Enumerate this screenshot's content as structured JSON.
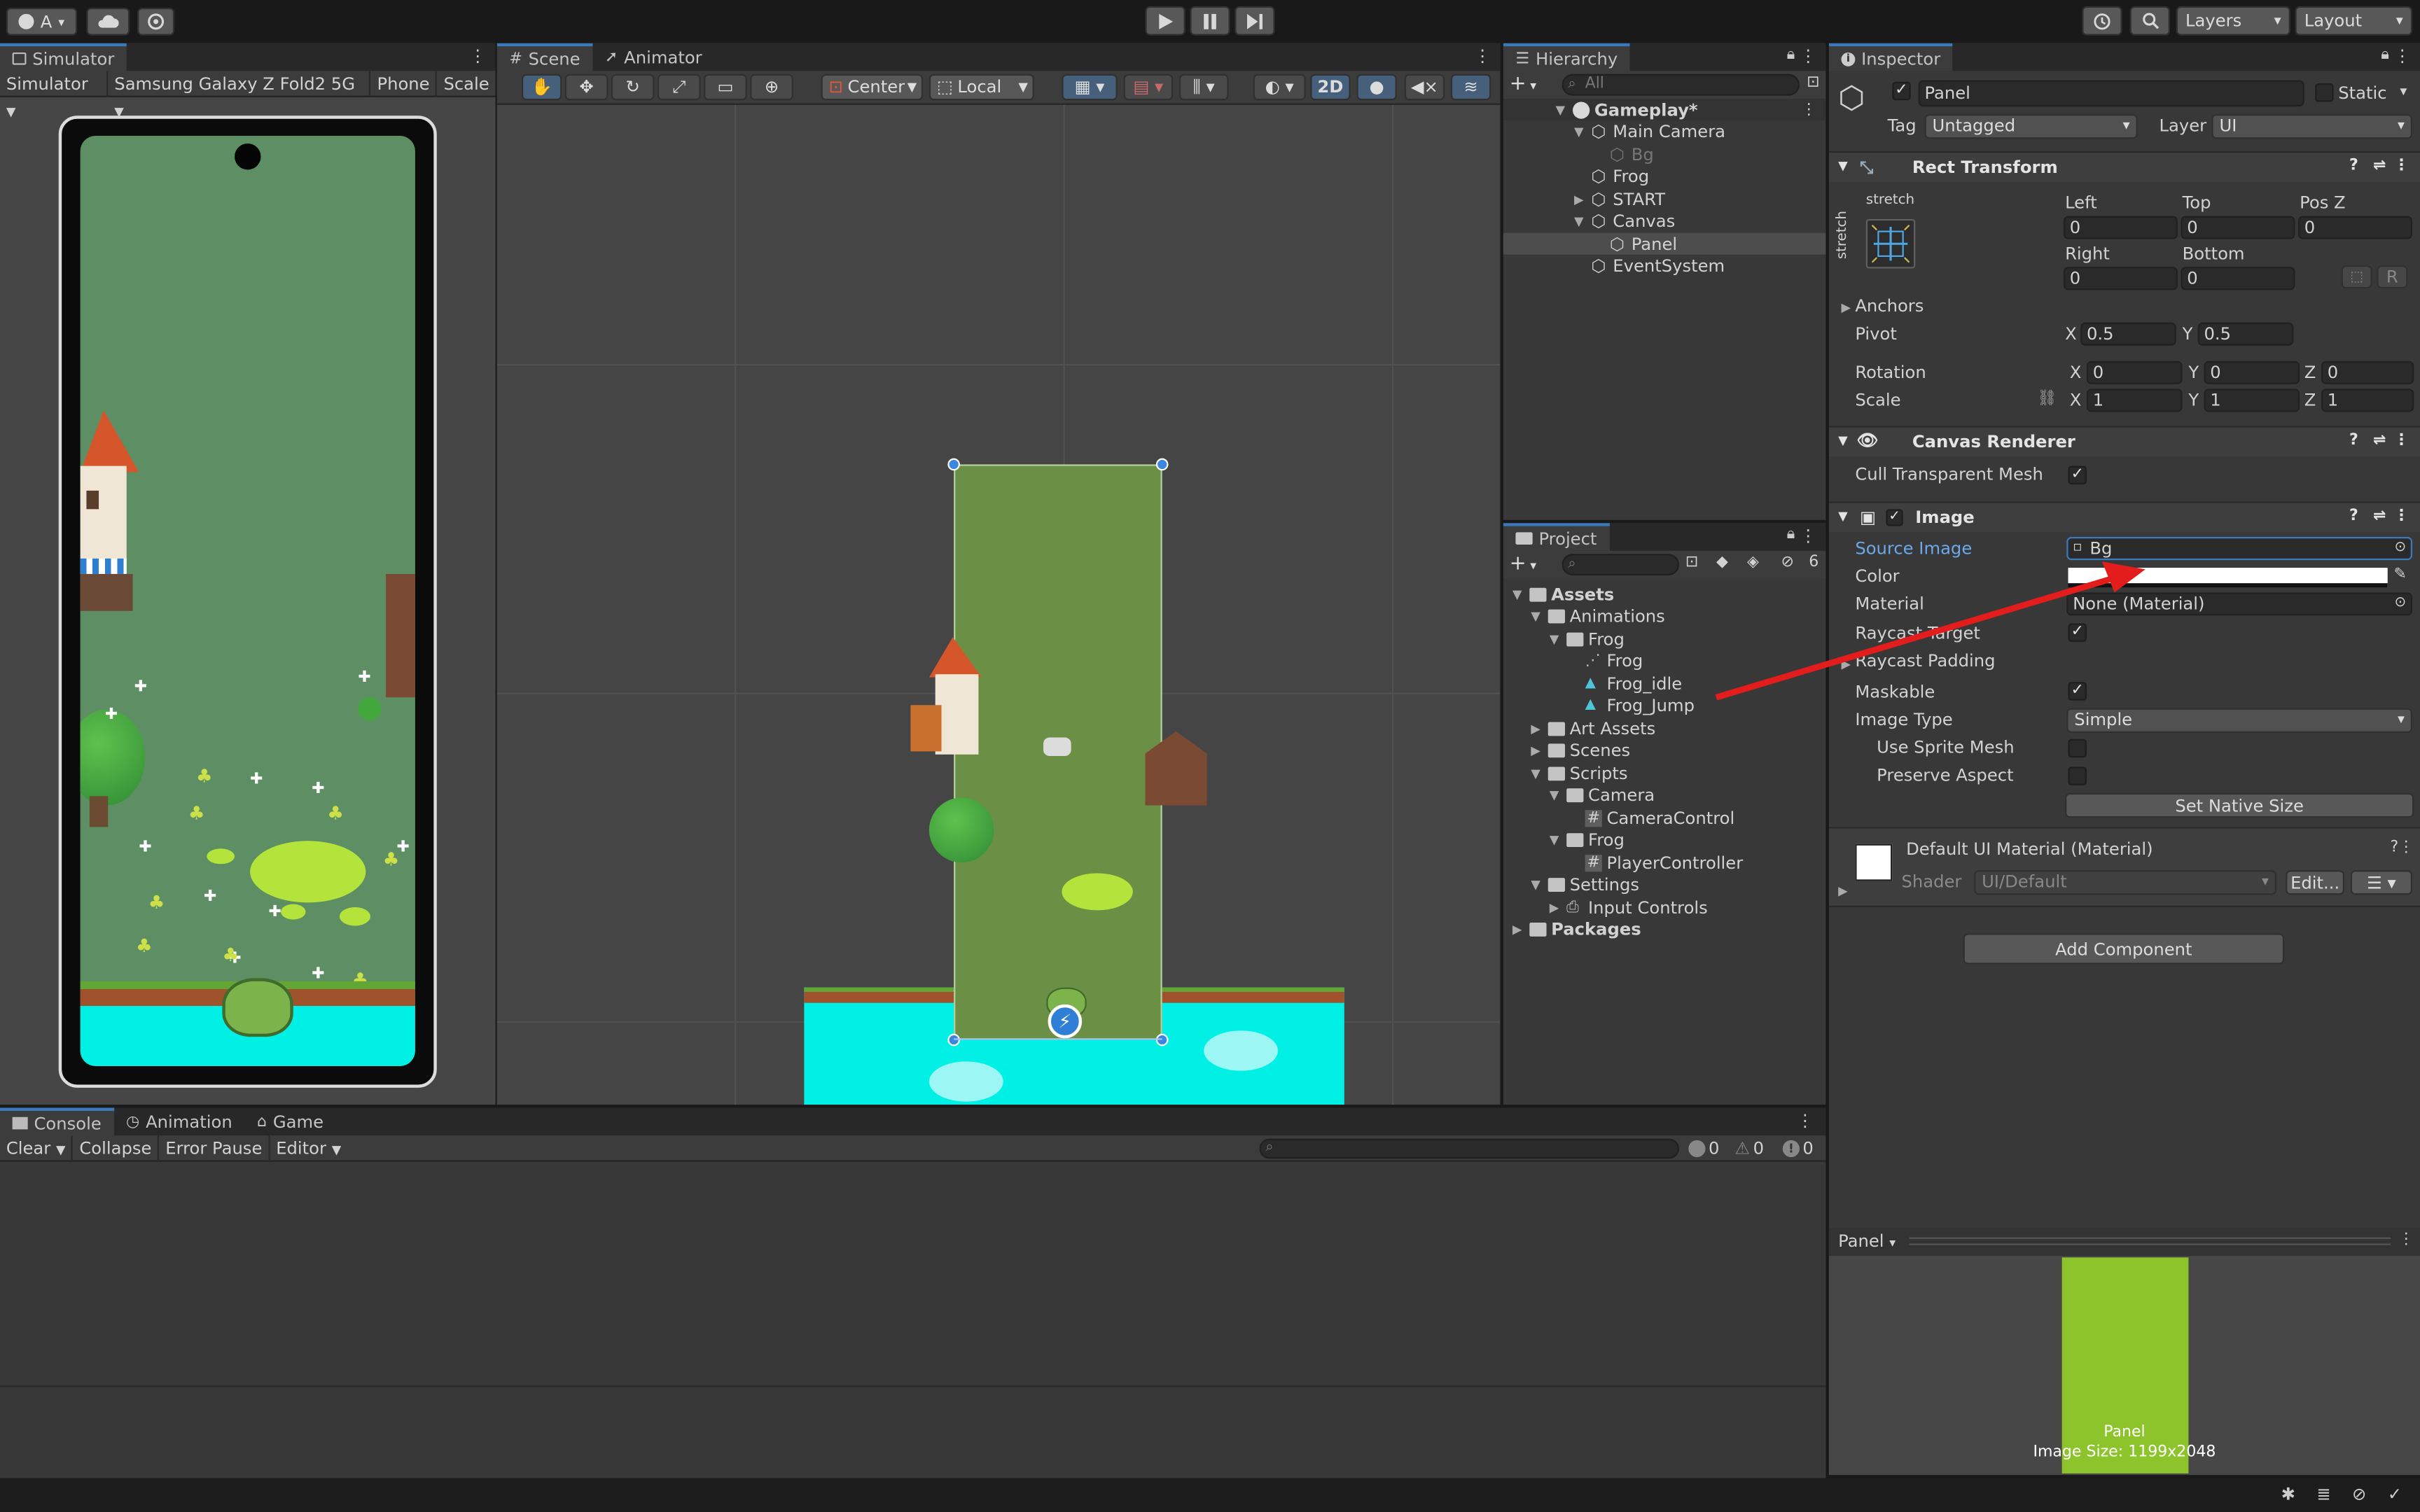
{
  "toolbar": {
    "account": "A",
    "layers": "Layers",
    "layout": "Layout"
  },
  "simulator": {
    "tab": "Simulator",
    "mode": "Simulator",
    "device": "Samsung Galaxy Z Fold2 5G",
    "platform": "Phone",
    "scale": "Scale"
  },
  "scene": {
    "tab_scene": "Scene",
    "tab_animator": "Animator",
    "pivot": "Center",
    "space": "Local",
    "two_d": "2D"
  },
  "hierarchy": {
    "tab": "Hierarchy",
    "search_placeholder": "All",
    "items": [
      {
        "label": "Gameplay*",
        "depth": 0,
        "arrow": "▼",
        "kind": "scene"
      },
      {
        "label": "Main Camera",
        "depth": 1,
        "arrow": "▼",
        "kind": "cube"
      },
      {
        "label": "Bg",
        "depth": 2,
        "arrow": "",
        "kind": "cube-dim"
      },
      {
        "label": "Frog",
        "depth": 1,
        "arrow": "",
        "kind": "cube"
      },
      {
        "label": "START",
        "depth": 1,
        "arrow": "▶",
        "kind": "cube"
      },
      {
        "label": "Canvas",
        "depth": 1,
        "arrow": "▼",
        "kind": "cube"
      },
      {
        "label": "Panel",
        "depth": 2,
        "arrow": "",
        "kind": "cube",
        "selected": true
      },
      {
        "label": "EventSystem",
        "depth": 1,
        "arrow": "",
        "kind": "cube"
      }
    ]
  },
  "project": {
    "tab": "Project",
    "hidden_count": "6",
    "items": [
      {
        "label": "Assets",
        "depth": 0,
        "arrow": "▼",
        "kind": "folder",
        "bold": true
      },
      {
        "label": "Animations",
        "depth": 1,
        "arrow": "▼",
        "kind": "folder"
      },
      {
        "label": "Frog",
        "depth": 2,
        "arrow": "▼",
        "kind": "folder"
      },
      {
        "label": "Frog",
        "depth": 3,
        "arrow": "",
        "kind": "anim-ctrl"
      },
      {
        "label": "Frog_idle",
        "depth": 3,
        "arrow": "",
        "kind": "anim"
      },
      {
        "label": "Frog_Jump",
        "depth": 3,
        "arrow": "",
        "kind": "anim"
      },
      {
        "label": "Art Assets",
        "depth": 1,
        "arrow": "▶",
        "kind": "folder"
      },
      {
        "label": "Scenes",
        "depth": 1,
        "arrow": "▶",
        "kind": "folder"
      },
      {
        "label": "Scripts",
        "depth": 1,
        "arrow": "▼",
        "kind": "folder"
      },
      {
        "label": "Camera",
        "depth": 2,
        "arrow": "▼",
        "kind": "folder"
      },
      {
        "label": "CameraControl",
        "depth": 3,
        "arrow": "",
        "kind": "script"
      },
      {
        "label": "Frog",
        "depth": 2,
        "arrow": "▼",
        "kind": "folder"
      },
      {
        "label": "PlayerController",
        "depth": 3,
        "arrow": "",
        "kind": "script"
      },
      {
        "label": "Settings",
        "depth": 1,
        "arrow": "▼",
        "kind": "folder"
      },
      {
        "label": "Input Controls",
        "depth": 2,
        "arrow": "▶",
        "kind": "input"
      },
      {
        "label": "Packages",
        "depth": 0,
        "arrow": "▶",
        "kind": "folder",
        "bold": true
      }
    ]
  },
  "inspector": {
    "tab": "Inspector",
    "object_name": "Panel",
    "static": "Static",
    "tag_label": "Tag",
    "tag": "Untagged",
    "layer_label": "Layer",
    "layer": "UI",
    "rect": {
      "title": "Rect Transform",
      "anchor_preset": "stretch",
      "left_label": "Left",
      "top_label": "Top",
      "posz_label": "Pos Z",
      "left": "0",
      "top": "0",
      "posz": "0",
      "right_label": "Right",
      "bottom_label": "Bottom",
      "right": "0",
      "bottom": "0",
      "r_btn": "R",
      "anchors": "Anchors",
      "pivot": "Pivot",
      "pivot_x": "0.5",
      "pivot_y": "0.5",
      "rotation": "Rotation",
      "rot_x": "0",
      "rot_y": "0",
      "rot_z": "0",
      "scale": "Scale",
      "scale_x": "1",
      "scale_y": "1",
      "scale_z": "1",
      "x": "X",
      "y": "Y",
      "z": "Z"
    },
    "canvas_renderer": {
      "title": "Canvas Renderer",
      "cull": "Cull Transparent Mesh"
    },
    "image": {
      "title": "Image",
      "source_image": "Source Image",
      "source_value": "Bg",
      "color": "Color",
      "color_value": "#ffffff",
      "material": "Material",
      "material_value": "None (Material)",
      "raycast_target": "Raycast Target",
      "raycast_padding": "Raycast Padding",
      "maskable": "Maskable",
      "image_type": "Image Type",
      "image_type_value": "Simple",
      "use_sprite_mesh": "Use Sprite Mesh",
      "preserve_aspect": "Preserve Aspect",
      "set_native": "Set Native Size"
    },
    "material": {
      "title": "Default UI Material (Material)",
      "shader_label": "Shader",
      "shader": "UI/Default",
      "edit": "Edit..."
    },
    "add_component": "Add Component",
    "preview": {
      "dropdown": "Panel",
      "name": "Panel",
      "size": "Image Size: 1199x2048"
    }
  },
  "console": {
    "tab_console": "Console",
    "tab_animation": "Animation",
    "tab_game": "Game",
    "clear": "Clear",
    "collapse": "Collapse",
    "error_pause": "Error Pause",
    "editor": "Editor",
    "count_log": "0",
    "count_warn": "0",
    "count_err": "0"
  },
  "colors": {
    "accent": "#3a79bb",
    "grass": "#5e8f64",
    "water": "#00e5e0",
    "lime": "#8ec42b",
    "annotation_arrow": "#e31c1c"
  }
}
